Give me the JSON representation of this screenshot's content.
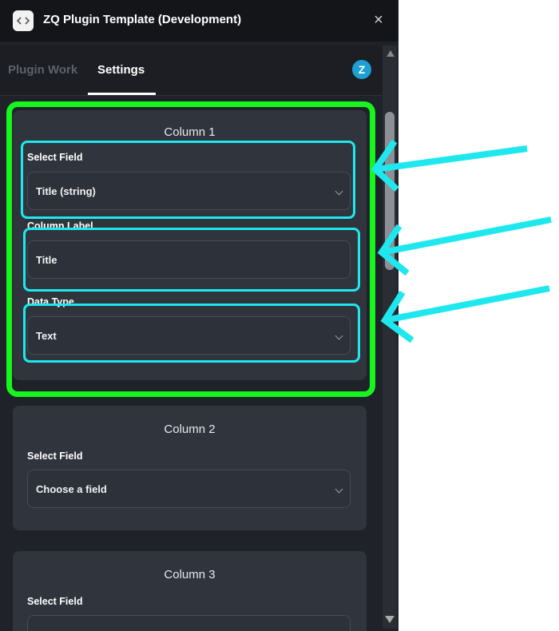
{
  "window": {
    "title": "ZQ Plugin Template (Development)",
    "close_glyph": "×"
  },
  "tabs": [
    {
      "label": "Plugin Work",
      "active": false
    },
    {
      "label": "Settings",
      "active": true
    }
  ],
  "brand_badge": "Z",
  "columns": [
    {
      "title": "Column 1",
      "select_field_label": "Select Field",
      "select_field_value": "Title (string)",
      "column_label_label": "Column Label",
      "column_label_value": "Title",
      "data_type_label": "Data Type",
      "data_type_value": "Text"
    },
    {
      "title": "Column 2",
      "select_field_label": "Select Field",
      "select_field_value": "Choose a field"
    },
    {
      "title": "Column 3",
      "select_field_label": "Select Field"
    }
  ],
  "colors": {
    "highlight_green": "#16f51d",
    "highlight_cyan": "#1ee8ee",
    "panel_bg": "#1f2228",
    "card_bg": "#30343d"
  },
  "icons": [
    "code-icon",
    "close-icon",
    "brand-logo-icon",
    "chevron-down-icon"
  ]
}
